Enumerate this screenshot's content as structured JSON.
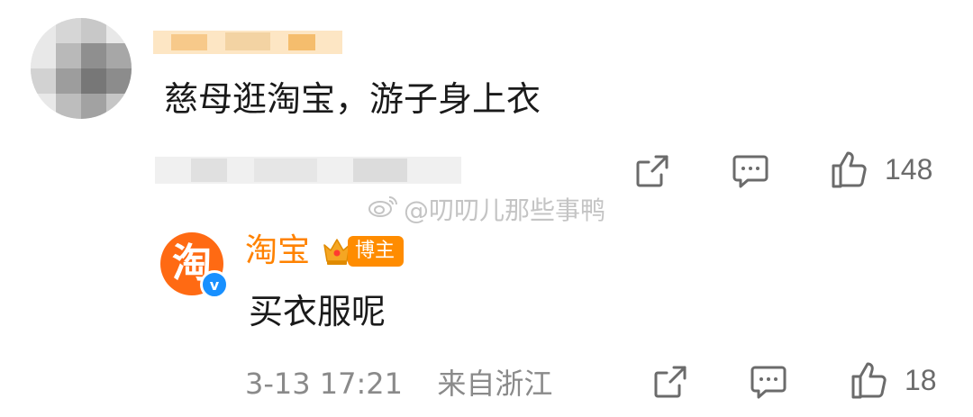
{
  "top_comment": {
    "text": "慈母逛淘宝，游子身上衣",
    "like_count": "148"
  },
  "watermark": {
    "text": "@叨叨儿那些事鸭"
  },
  "reply": {
    "author_name": "淘宝",
    "avatar_glyph": "淘",
    "badge_label": "博主",
    "text": "买衣服呢",
    "timestamp": "3-13 17:21",
    "source": "来自浙江",
    "like_count": "18"
  },
  "colors": {
    "brand_orange": "#ff8200",
    "avatar_orange": "#ff6a13",
    "verified_blue": "#1890ff",
    "icon_gray": "#6b6b6b"
  },
  "icons": {
    "share": "share-icon",
    "comment": "comment-icon",
    "like": "thumbs-up-icon",
    "crown": "crown-icon",
    "verified": "verified-icon",
    "weibo": "weibo-icon"
  }
}
